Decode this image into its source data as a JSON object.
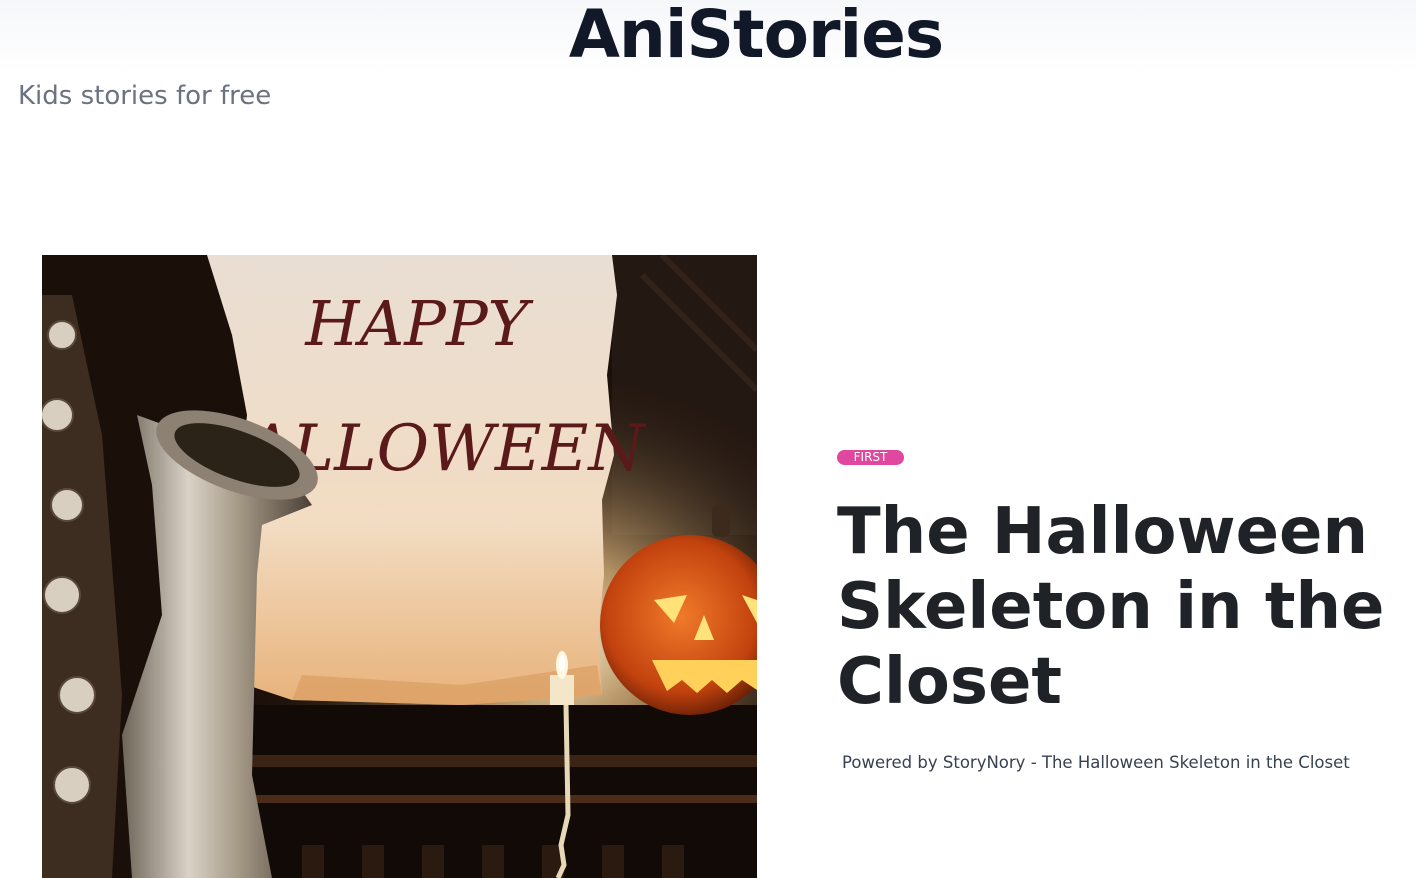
{
  "header": {
    "site_title": "AniStories",
    "tagline": "Kids stories for free"
  },
  "featured_story": {
    "category": "FIRST",
    "title": "The Halloween Skeleton in the Closet",
    "credit": "Powered by StoryNory - The Halloween Skeleton in the Closet",
    "image_alt": "Happy Halloween scroll with saxophone, candle and jack-o'-lantern",
    "image_text_line1": "HAPPY",
    "image_text_line2": "HALLOWEEN"
  },
  "colors": {
    "title": "#111827",
    "tagline": "#6b7280",
    "badge_bg": "#e0479e",
    "story_title": "#1f2328"
  }
}
